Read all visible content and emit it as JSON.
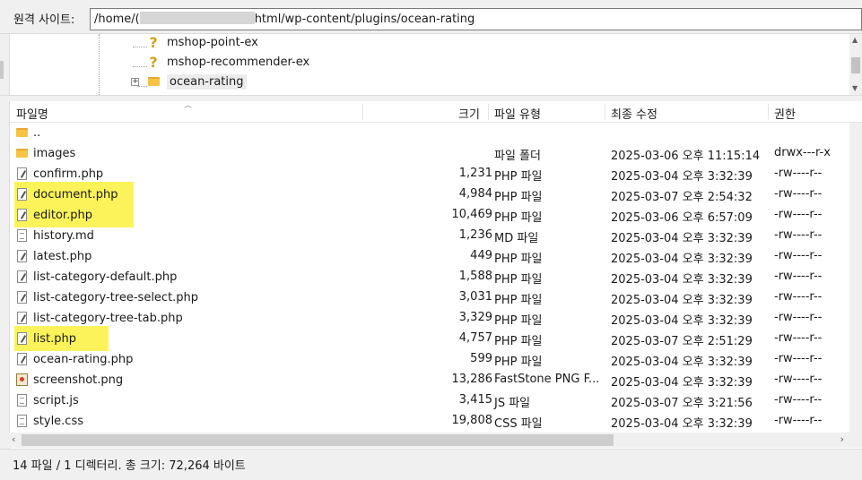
{
  "remote_site": {
    "label": "원격 사이트:",
    "path_prefix": "/home/(",
    "path_suffix": "html/wp-content/plugins/ocean-rating"
  },
  "tree": {
    "items": [
      {
        "label": "mshop-point-ex",
        "icon": "question-folder-icon"
      },
      {
        "label": "mshop-recommender-ex",
        "icon": "question-folder-icon"
      },
      {
        "label": "ocean-rating",
        "icon": "folder-icon",
        "expander": "+"
      }
    ]
  },
  "columns": {
    "name": "파일명",
    "size": "크기",
    "type": "파일 유형",
    "modified": "최종 수정",
    "perms": "권한"
  },
  "files": [
    {
      "name": "..",
      "size": "",
      "type": "",
      "modified": "",
      "perms": "",
      "icon": "folder-icon",
      "highlight": false
    },
    {
      "name": "images",
      "size": "",
      "type": "파일 폴더",
      "modified": "2025-03-06 오후 11:15:14",
      "perms": "drwx---r-x",
      "icon": "folder-icon",
      "highlight": false
    },
    {
      "name": "confirm.php",
      "size": "1,231",
      "type": "PHP 파일",
      "modified": "2025-03-04 오후 3:32:39",
      "perms": "-rw----r--",
      "icon": "php-file-icon",
      "highlight": false
    },
    {
      "name": "document.php",
      "size": "4,984",
      "type": "PHP 파일",
      "modified": "2025-03-07 오후 2:54:32",
      "perms": "-rw----r--",
      "icon": "php-file-icon",
      "highlight": true
    },
    {
      "name": "editor.php",
      "size": "10,469",
      "type": "PHP 파일",
      "modified": "2025-03-06 오후 6:57:09",
      "perms": "-rw----r--",
      "icon": "php-file-icon",
      "highlight": true
    },
    {
      "name": "history.md",
      "size": "1,236",
      "type": "MD 파일",
      "modified": "2025-03-04 오후 3:32:39",
      "perms": "-rw----r--",
      "icon": "file-icon",
      "highlight": false
    },
    {
      "name": "latest.php",
      "size": "449",
      "type": "PHP 파일",
      "modified": "2025-03-04 오후 3:32:39",
      "perms": "-rw----r--",
      "icon": "php-file-icon",
      "highlight": false
    },
    {
      "name": "list-category-default.php",
      "size": "1,588",
      "type": "PHP 파일",
      "modified": "2025-03-04 오후 3:32:39",
      "perms": "-rw----r--",
      "icon": "php-file-icon",
      "highlight": false
    },
    {
      "name": "list-category-tree-select.php",
      "size": "3,031",
      "type": "PHP 파일",
      "modified": "2025-03-04 오후 3:32:39",
      "perms": "-rw----r--",
      "icon": "php-file-icon",
      "highlight": false
    },
    {
      "name": "list-category-tree-tab.php",
      "size": "3,329",
      "type": "PHP 파일",
      "modified": "2025-03-04 오후 3:32:39",
      "perms": "-rw----r--",
      "icon": "php-file-icon",
      "highlight": false
    },
    {
      "name": "list.php",
      "size": "4,757",
      "type": "PHP 파일",
      "modified": "2025-03-07 오후 2:51:29",
      "perms": "-rw----r--",
      "icon": "php-file-icon",
      "highlight": true
    },
    {
      "name": "ocean-rating.php",
      "size": "599",
      "type": "PHP 파일",
      "modified": "2025-03-04 오후 3:32:39",
      "perms": "-rw----r--",
      "icon": "php-file-icon",
      "highlight": false
    },
    {
      "name": "screenshot.png",
      "size": "13,286",
      "type": "FastStone PNG F...",
      "modified": "2025-03-04 오후 3:32:39",
      "perms": "-rw----r--",
      "icon": "image-file-icon",
      "highlight": false
    },
    {
      "name": "script.js",
      "size": "3,415",
      "type": "JS 파일",
      "modified": "2025-03-07 오후 3:21:56",
      "perms": "-rw----r--",
      "icon": "file-icon",
      "highlight": false
    },
    {
      "name": "style.css",
      "size": "19,808",
      "type": "CSS 파일",
      "modified": "2025-03-04 오후 3:32:39",
      "perms": "-rw----r--",
      "icon": "file-icon",
      "highlight": false
    }
  ],
  "status": {
    "text": "14 파일 / 1 디렉터리. 총 크기: 72,264 바이트"
  },
  "colors": {
    "highlight": "#fcf35a",
    "folder": "#f5c445"
  }
}
